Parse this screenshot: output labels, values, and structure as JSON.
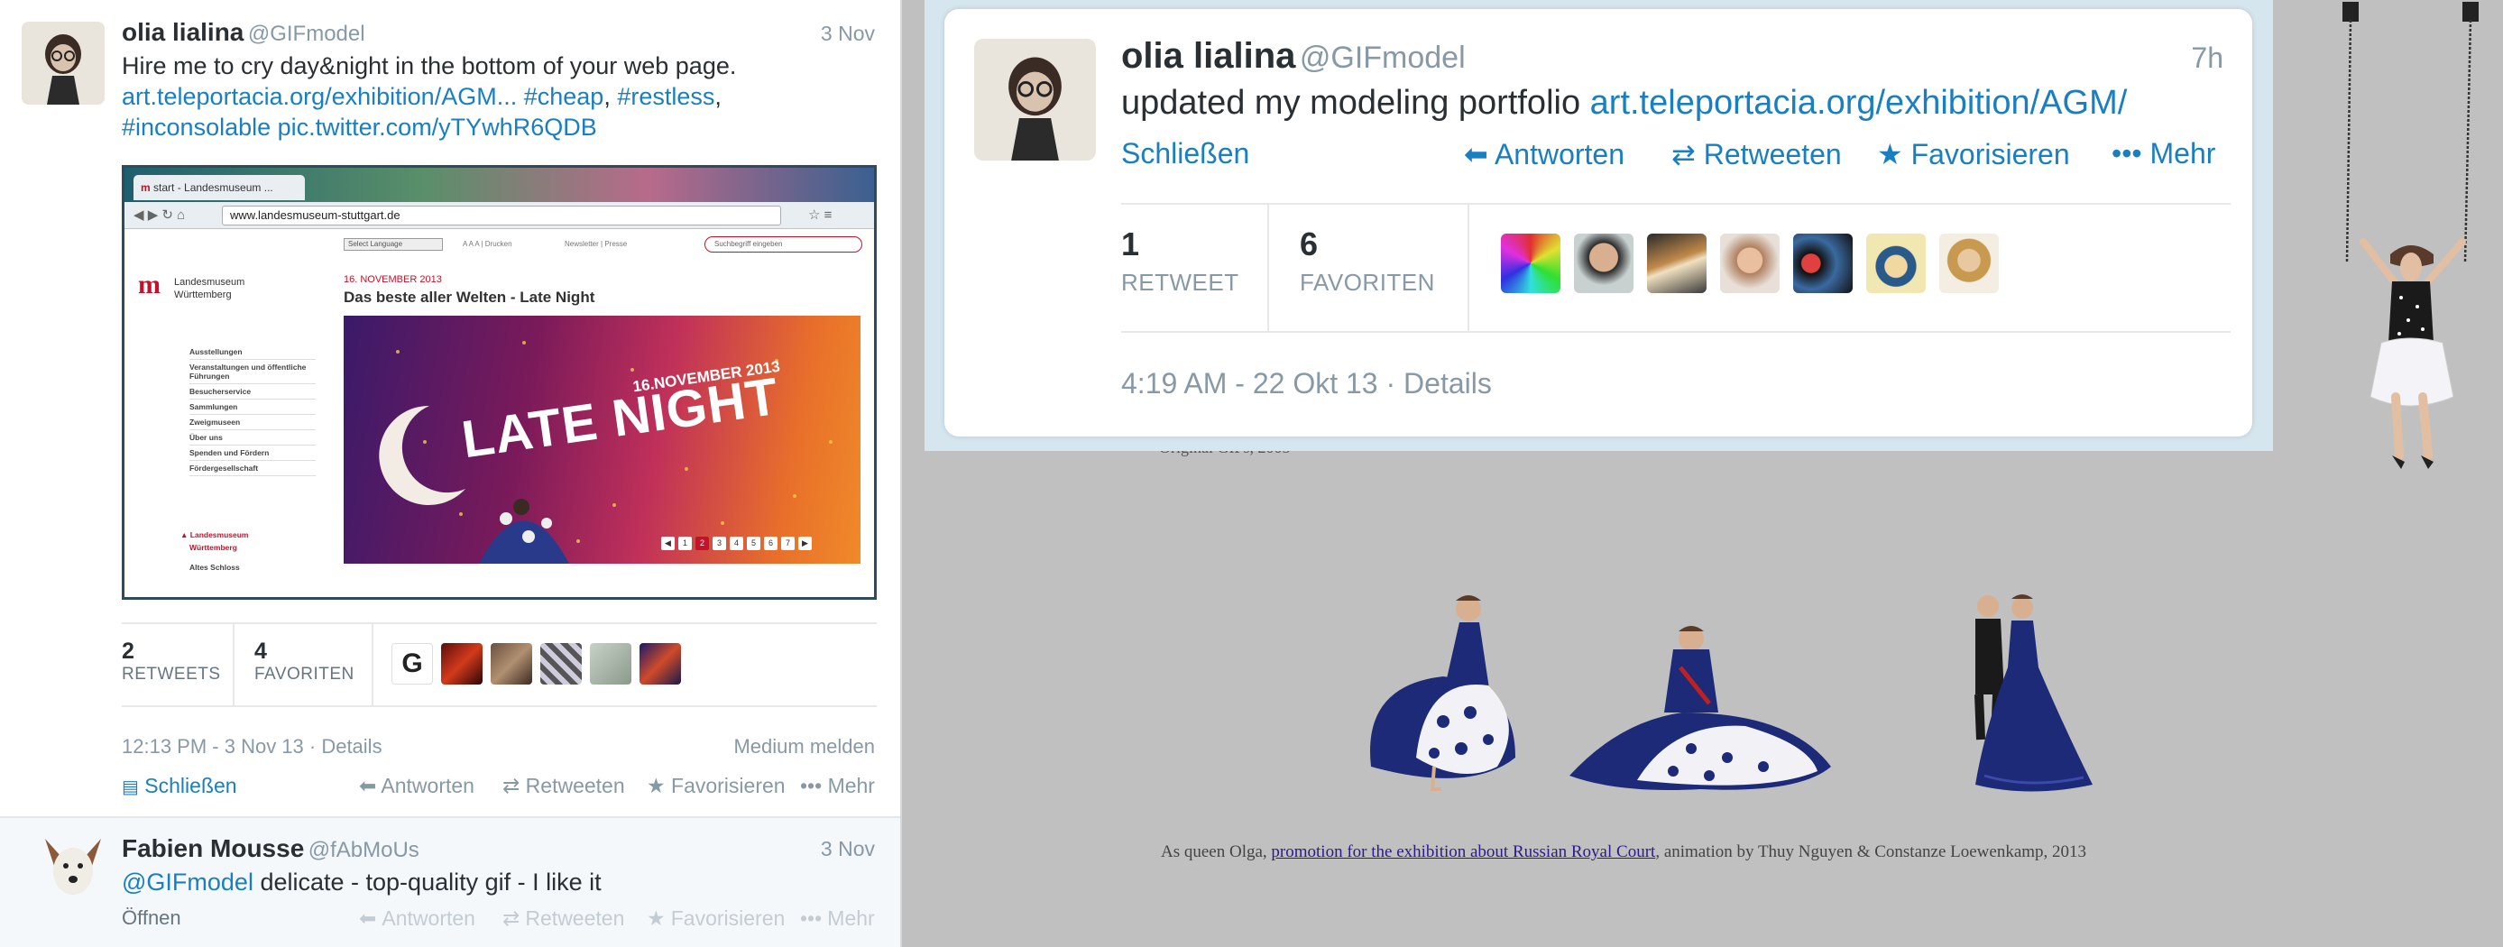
{
  "tweet1": {
    "name": "olia lialina",
    "handle": "@GIFmodel",
    "date": "3 Nov",
    "text_line1": "Hire me to cry day&night in the bottom of your web page.",
    "link1": "art.teleportacia.org/exhibition/AGM...",
    "tag_cheap": "#cheap",
    "tag_restless": "#restless",
    "tag_inconsolable": "#inconsolable",
    "pic_link": "pic.twitter.com/yTYwhR6QDB",
    "retweets_count": "2",
    "retweets_label": "RETWEETS",
    "favorites_count": "4",
    "favorites_label": "FAVORITEN",
    "timestamp": "12:13 PM - 3 Nov 13 · Details",
    "report": "Medium melden",
    "close": "Schließen",
    "reply": "Antworten",
    "retweet": "Retweeten",
    "favorite": "Favorisieren",
    "more": "Mehr"
  },
  "browser": {
    "tab_title": "start - Landesmuseum ...",
    "url": "www.landesmuseum-stuttgart.de",
    "select_language": "Select Language",
    "font_size_ctrl": "A A A | Drucken",
    "newsletter": "Newsletter | Presse",
    "search_placeholder": "Suchbegriff eingeben",
    "logo_line1": "Landesmuseum",
    "logo_line2": "Württemberg",
    "date": "16. NOVEMBER 2013",
    "headline": "Das beste aller Welten - Late Night",
    "banner_date": "16.NOVEMBER 2013",
    "banner_title": "LATE NIGHT",
    "nav": [
      "Ausstellungen",
      "Veranstaltungen und öffentliche Führungen",
      "Besucherservice",
      "Sammlungen",
      "Zweigmuseen",
      "Über uns",
      "Spenden und Fördern",
      "Fördergesellschaft"
    ],
    "nav_active1": "Landesmuseum",
    "nav_active2": "Württemberg",
    "nav_last": "Altes Schloss",
    "pages": [
      "1",
      "2",
      "3",
      "4",
      "5",
      "6",
      "7"
    ]
  },
  "tweet2": {
    "name": "Fabien Mousse",
    "handle": "@fAbMoUs",
    "date": "3 Nov",
    "mention": "@GIFmodel",
    "text": "delicate - top-quality gif - I like it",
    "open": "Öffnen",
    "reply": "Antworten",
    "retweet": "Retweeten",
    "favorite": "Favorisieren",
    "more": "Mehr"
  },
  "card": {
    "name": "olia lialina",
    "handle": "@GIFmodel",
    "time": "7h",
    "text": "updated my modeling portfolio",
    "link": "art.teleportacia.org/exhibition/AGM/",
    "close": "Schließen",
    "reply": "Antworten",
    "retweet": "Retweeten",
    "favorite": "Favorisieren",
    "more": "Mehr",
    "retweets_count": "1",
    "retweets_label": "RETWEET",
    "favorites_count": "6",
    "favorites_label": "FAVORITEN",
    "timestamp": "4:19 AM - 22 Okt 13 · Details"
  },
  "page": {
    "partial_caption": "Original GIFs, 2005",
    "caption_prefix": "As queen Olga, ",
    "caption_link": "promotion for the exhibition about Russian Royal Court",
    "caption_suffix": ", animation by Thuy Nguyen & Constanze Loewenkamp, 2013"
  },
  "colors": {
    "twitter_blue": "#1a7fc1",
    "page_gray": "#c0c0c0",
    "gown_blue": "#1c2a78"
  }
}
